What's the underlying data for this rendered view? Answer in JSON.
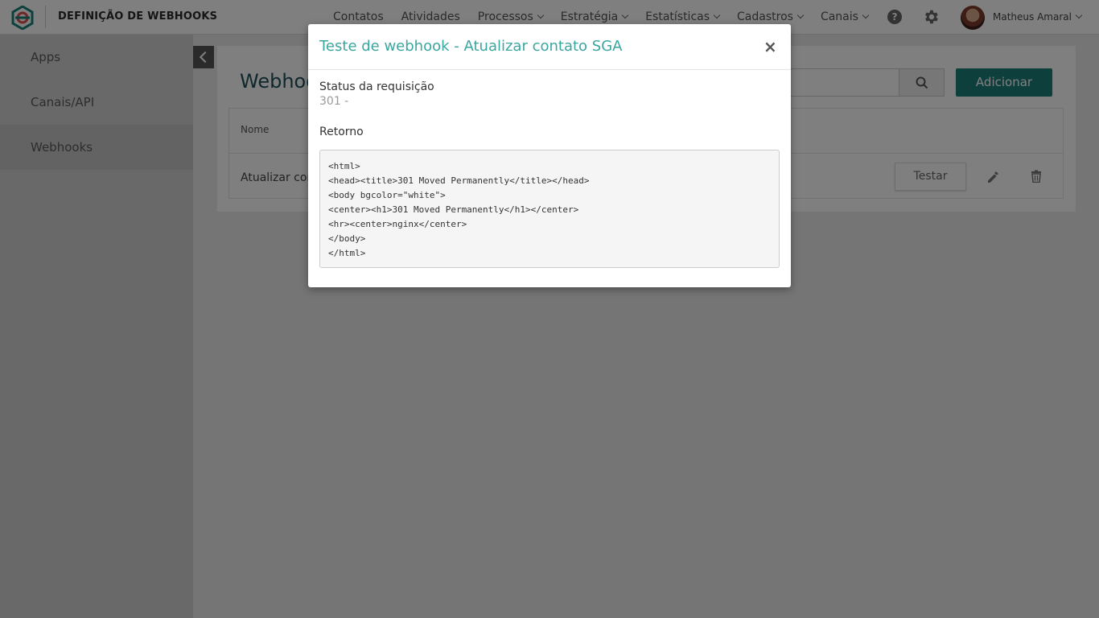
{
  "topbar": {
    "page_title": "DEFINIÇÃO DE WEBHOOKS",
    "nav": [
      {
        "label": "Contatos",
        "dropdown": false
      },
      {
        "label": "Atividades",
        "dropdown": false
      },
      {
        "label": "Processos",
        "dropdown": true
      },
      {
        "label": "Estratégia",
        "dropdown": true
      },
      {
        "label": "Estatísticas",
        "dropdown": true
      },
      {
        "label": "Cadastros",
        "dropdown": true
      },
      {
        "label": "Canais",
        "dropdown": true
      }
    ],
    "help_icon": "?",
    "user_name": "Matheus Amaral"
  },
  "sidebar": {
    "items": [
      {
        "label": "Apps"
      },
      {
        "label": "Canais/API"
      },
      {
        "label": "Webhooks"
      }
    ],
    "active_index": 2
  },
  "main": {
    "title": "Webhooks",
    "add_button": "Adicionar",
    "table": {
      "column_name": "Nome",
      "rows": [
        {
          "name": "Atualizar contato SGA",
          "test_label": "Testar"
        }
      ]
    }
  },
  "modal": {
    "title": "Teste de webhook - Atualizar contato SGA",
    "status_label": "Status da requisição",
    "status_value": "301 -",
    "return_label": "Retorno",
    "response_body": "<html>\n<head><title>301 Moved Permanently</title></head>\n<body bgcolor=\"white\">\n<center><h1>301 Moved Permanently</h1></center>\n<hr><center>nginx</center>\n</body>\n</html>"
  },
  "colors": {
    "accent": "#3aa6a0",
    "primary_button": "#1a8178",
    "overlay": "rgba(0,0,0,0.5)"
  }
}
